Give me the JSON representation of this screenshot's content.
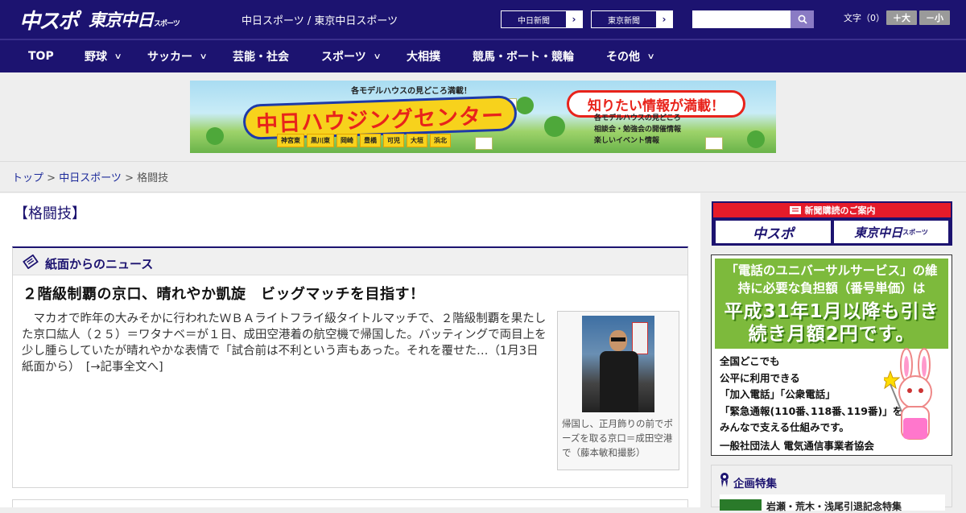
{
  "header": {
    "logo_primary": "中スポ",
    "logo_secondary": "東京中日",
    "logo_secondary_small": "スポーツ",
    "site_links": "中日スポーツ / 東京中日スポーツ",
    "ext_buttons": [
      "中日新聞",
      "東京新聞"
    ],
    "search_placeholder": "",
    "font_size_label": "文字（0）",
    "font_increase": "＋大",
    "font_decrease": "－小"
  },
  "nav": {
    "items": [
      {
        "label": "TOP",
        "has_dropdown": false
      },
      {
        "label": "野球",
        "has_dropdown": true
      },
      {
        "label": "サッカー",
        "has_dropdown": true
      },
      {
        "label": "芸能・社会",
        "has_dropdown": false
      },
      {
        "label": "スポーツ",
        "has_dropdown": true
      },
      {
        "label": "大相撲",
        "has_dropdown": false
      },
      {
        "label": "競馬・ボート・競輪",
        "has_dropdown": false
      },
      {
        "label": "その他",
        "has_dropdown": true
      }
    ]
  },
  "banner": {
    "top_text": "各モデルハウスの見どころ満載！",
    "title": "中日ハウジングセンター",
    "bubble": "知りたい情報が満載！",
    "towns": [
      "神宮東",
      "黒川東",
      "岡崎",
      "豊橋",
      "可児",
      "大垣",
      "浜北"
    ],
    "lines": [
      "各モデルハウスの見どころ",
      "相談会・勉強会の開催情報",
      "楽しいイベント情報"
    ]
  },
  "breadcrumb": {
    "home": "トップ",
    "sep": " > ",
    "section": "中日スポーツ",
    "current": "格闘技"
  },
  "page": {
    "title": "【格闘技】"
  },
  "news": {
    "section_title": "紙面からのニュース",
    "article": {
      "title": "２階級制覇の京口、晴れやか凱旋　ビッグマッチを目指す！",
      "body": "　マカオで昨年の大みそかに行われたＷＢＡライトフライ級タイトルマッチで、２階級制覇を果たした京口紘人（２５）＝ワタナベ＝が１日、成田空港着の航空機で帰国した。バッティングで両目上を少し腫らしていたが晴れやかな表情で「試合前は不利という声もあった。それを覆せた…（1月3日 紙面から）　",
      "more": "[→記事全文へ]",
      "photo_caption": "帰国し、正月飾りの前でポーズを取る京口＝成田空港で（藤本敏和撮影）"
    }
  },
  "sidebar": {
    "subscribe_head": "新聞購読のご案内",
    "subscribe_logos": [
      "中スポ",
      "東京中日"
    ],
    "subscribe_logo_small": "スポーツ",
    "universal_ad": {
      "question": "「電話のユニバーサルサービス」の維持に必要な負担額（番号単価）は",
      "headline": "平成31年1月以降も引き続き月額2円です。",
      "lines": [
        "全国どこでも",
        "公平に利用できる",
        "「加入電話」「公衆電話」",
        "「緊急通報(110番､118番､119番)」を",
        "みんなで支える仕組みです。"
      ],
      "org": "一般社団法人 電気通信事業者協会"
    },
    "feature": {
      "title": "企画特集",
      "item": "岩瀬・荒木・浅尾引退記念特集"
    }
  },
  "colors": {
    "brand_navy": "#1c1370",
    "accent_red": "#e51b2a",
    "ad_green": "#7dba3c"
  }
}
